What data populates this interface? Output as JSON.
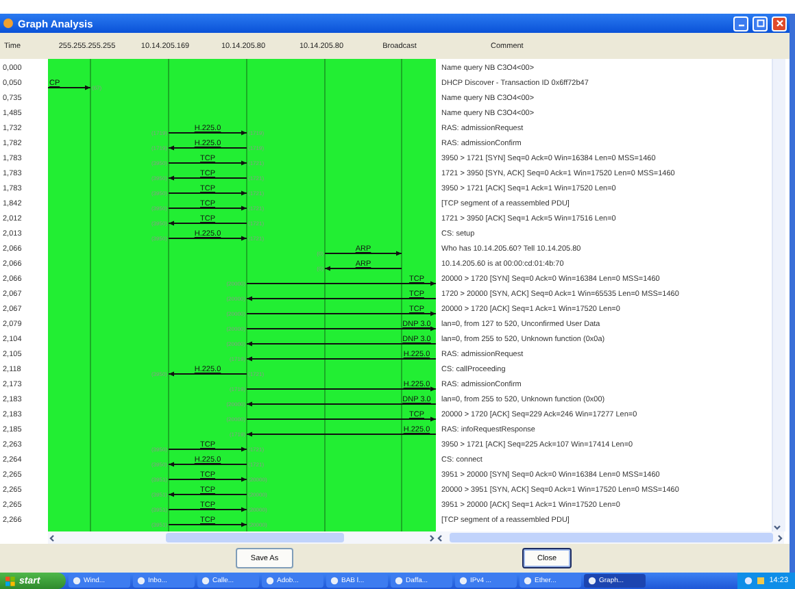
{
  "window": {
    "title": "Graph Analysis"
  },
  "header": {
    "time": "Time",
    "nodes": [
      "255.255.255.255",
      "10.14.205.169",
      "10.14.205.80",
      "10.14.205.80",
      "Broadcast"
    ],
    "comment": "Comment"
  },
  "rows": [
    {
      "time": "0,000",
      "comment": "Name query NB C3O4<00>"
    },
    {
      "time": "0,050",
      "comment": "DHCP Discover - Transaction ID 0x6ff72b47",
      "arrow": {
        "kind": "outer_to_first",
        "leftward": false,
        "protocol": "CP",
        "right_port": "(67)"
      }
    },
    {
      "time": "0,735",
      "comment": "Name query NB C3O4<00>"
    },
    {
      "time": "1,485",
      "comment": "Name query NB C3O4<00>"
    },
    {
      "time": "1,732",
      "comment": "RAS: admissionRequest",
      "arrow": {
        "kind": "second_to_third",
        "leftward": false,
        "protocol": "H.225.0",
        "left_port": "(1719)",
        "right_port": "(1719)"
      }
    },
    {
      "time": "1,782",
      "comment": "RAS: admissionConfirm",
      "arrow": {
        "kind": "second_to_third",
        "leftward": true,
        "protocol": "H.225.0",
        "left_port": "(1719)",
        "right_port": "(1719)"
      }
    },
    {
      "time": "1,783",
      "comment": "3950 > 1721 [SYN] Seq=0 Ack=0 Win=16384 Len=0 MSS=1460",
      "arrow": {
        "kind": "second_to_third",
        "leftward": false,
        "protocol": "TCP",
        "left_port": "(3950)",
        "right_port": "(1721)"
      }
    },
    {
      "time": "1,783",
      "comment": "1721 > 3950 [SYN, ACK] Seq=0 Ack=1 Win=17520 Len=0 MSS=1460",
      "arrow": {
        "kind": "second_to_third",
        "leftward": true,
        "protocol": "TCP",
        "left_port": "(3950)",
        "right_port": "(1721)"
      }
    },
    {
      "time": "1,783",
      "comment": "3950 > 1721 [ACK] Seq=1 Ack=1 Win=17520 Len=0",
      "arrow": {
        "kind": "second_to_third",
        "leftward": false,
        "protocol": "TCP",
        "left_port": "(3950)",
        "right_port": "(1721)"
      }
    },
    {
      "time": "1,842",
      "comment": "[TCP segment of a reassembled PDU]",
      "arrow": {
        "kind": "second_to_third",
        "leftward": false,
        "protocol": "TCP",
        "left_port": "(3950)",
        "right_port": "(1721)"
      }
    },
    {
      "time": "2,012",
      "comment": "1721 > 3950 [ACK] Seq=1 Ack=5 Win=17516 Len=0",
      "arrow": {
        "kind": "second_to_third",
        "leftward": true,
        "protocol": "TCP",
        "left_port": "(3950)",
        "right_port": "(1721)"
      }
    },
    {
      "time": "2,013",
      "comment": "CS: setup",
      "arrow": {
        "kind": "second_to_third",
        "leftward": false,
        "protocol": "H.225.0",
        "left_port": "(3950)",
        "right_port": "(1721)"
      }
    },
    {
      "time": "2,066",
      "comment": "Who has 10.14.205.60?  Tell 10.14.205.80",
      "arrow": {
        "kind": "fourth_to_fifth",
        "leftward": false,
        "protocol": "ARP",
        "left_port": "(0)"
      }
    },
    {
      "time": "2,066",
      "comment": "10.14.205.60 is at 00:00:cd:01:4b:70",
      "arrow": {
        "kind": "fourth_to_fifth",
        "leftward": true,
        "protocol": "ARP",
        "left_port": "(0)"
      }
    },
    {
      "time": "2,066",
      "comment": "20000 > 1720 [SYN] Seq=0 Ack=0 Win=16384 Len=0 MSS=1460",
      "arrow": {
        "kind": "third_to_outer",
        "leftward": false,
        "protocol": "TCP",
        "left_port": "(20000)"
      }
    },
    {
      "time": "2,067",
      "comment": "1720 > 20000 [SYN, ACK] Seq=0 Ack=1 Win=65535 Len=0 MSS=1460",
      "arrow": {
        "kind": "third_to_outer",
        "leftward": true,
        "protocol": "TCP",
        "left_port": "(20000)"
      }
    },
    {
      "time": "2,067",
      "comment": "20000 > 1720 [ACK] Seq=1 Ack=1 Win=17520 Len=0",
      "arrow": {
        "kind": "third_to_outer",
        "leftward": false,
        "protocol": "TCP",
        "left_port": "(20000)"
      }
    },
    {
      "time": "2,079",
      "comment": "lan=0, from 127 to 520, Unconfirmed User Data",
      "arrow": {
        "kind": "third_to_outer",
        "leftward": false,
        "protocol": "DNP 3.0",
        "left_port": "(20000)"
      }
    },
    {
      "time": "2,104",
      "comment": "lan=0, from 255 to 520, Unknown function (0x0a)",
      "arrow": {
        "kind": "third_to_outer",
        "leftward": true,
        "protocol": "DNP 3.0",
        "left_port": "(20000)"
      }
    },
    {
      "time": "2,105",
      "comment": "RAS: admissionRequest",
      "arrow": {
        "kind": "third_to_outer",
        "leftward": true,
        "protocol": "H.225.0",
        "left_port": "(1719)"
      }
    },
    {
      "time": "2,118",
      "comment": "CS: callProceeding",
      "arrow": {
        "kind": "second_to_third",
        "leftward": true,
        "protocol": "H.225.0",
        "left_port": "(3950)",
        "right_port": "(1721)"
      }
    },
    {
      "time": "2,173",
      "comment": "RAS: admissionConfirm",
      "arrow": {
        "kind": "third_to_outer",
        "leftward": false,
        "protocol": "H.225.0",
        "left_port": "(1719)"
      }
    },
    {
      "time": "2,183",
      "comment": "lan=0, from 255 to 520, Unknown function (0x00)",
      "arrow": {
        "kind": "third_to_outer",
        "leftward": true,
        "protocol": "DNP 3.0",
        "left_port": "(20000)"
      }
    },
    {
      "time": "2,183",
      "comment": "20000 > 1720 [ACK] Seq=229 Ack=246 Win=17277 Len=0",
      "arrow": {
        "kind": "third_to_outer",
        "leftward": false,
        "protocol": "TCP",
        "left_port": "(20000)"
      }
    },
    {
      "time": "2,185",
      "comment": "RAS: infoRequestResponse",
      "arrow": {
        "kind": "third_to_outer",
        "leftward": true,
        "protocol": "H.225.0",
        "left_port": "(1719)"
      }
    },
    {
      "time": "2,263",
      "comment": "3950 > 1721 [ACK] Seq=225 Ack=107 Win=17414 Len=0",
      "arrow": {
        "kind": "second_to_third",
        "leftward": false,
        "protocol": "TCP",
        "left_port": "(3950)",
        "right_port": "(1721)"
      }
    },
    {
      "time": "2,264",
      "comment": "CS: connect",
      "arrow": {
        "kind": "second_to_third",
        "leftward": true,
        "protocol": "H.225.0",
        "left_port": "(3950)",
        "right_port": "(1721)"
      }
    },
    {
      "time": "2,265",
      "comment": "3951 > 20000 [SYN] Seq=0 Ack=0 Win=16384 Len=0 MSS=1460",
      "arrow": {
        "kind": "second_to_third",
        "leftward": false,
        "protocol": "TCP",
        "left_port": "(3951)",
        "right_port": "(20000)"
      }
    },
    {
      "time": "2,265",
      "comment": "20000 > 3951 [SYN, ACK] Seq=0 Ack=1 Win=17520 Len=0 MSS=1460",
      "arrow": {
        "kind": "second_to_third",
        "leftward": true,
        "protocol": "TCP",
        "left_port": "(3951)",
        "right_port": "(20000)"
      }
    },
    {
      "time": "2,265",
      "comment": "3951 > 20000 [ACK] Seq=1 Ack=1 Win=17520 Len=0",
      "arrow": {
        "kind": "second_to_third",
        "leftward": false,
        "protocol": "TCP",
        "left_port": "(3951)",
        "right_port": "(20000)"
      }
    },
    {
      "time": "2,266",
      "comment": "[TCP segment of a reassembled PDU]",
      "arrow": {
        "kind": "second_to_third",
        "leftward": false,
        "protocol": "TCP",
        "left_port": "(3951)",
        "right_port": "(20000)"
      }
    }
  ],
  "buttons": [
    {
      "label": "Save As",
      "focused": false
    },
    {
      "label": "Close",
      "focused": true
    }
  ],
  "taskbar": {
    "start": "start",
    "items": [
      {
        "label": "Wind...",
        "selected": false
      },
      {
        "label": "Inbo...",
        "selected": false
      },
      {
        "label": "Calle...",
        "selected": false
      },
      {
        "label": "Adob...",
        "selected": false
      },
      {
        "label": "BAB l...",
        "selected": false
      },
      {
        "label": "Daffa...",
        "selected": false
      },
      {
        "label": "IPv4 ...",
        "selected": false
      },
      {
        "label": "Ether...",
        "selected": false
      },
      {
        "label": "Graph...",
        "selected": true
      }
    ],
    "clock": "14:23"
  }
}
